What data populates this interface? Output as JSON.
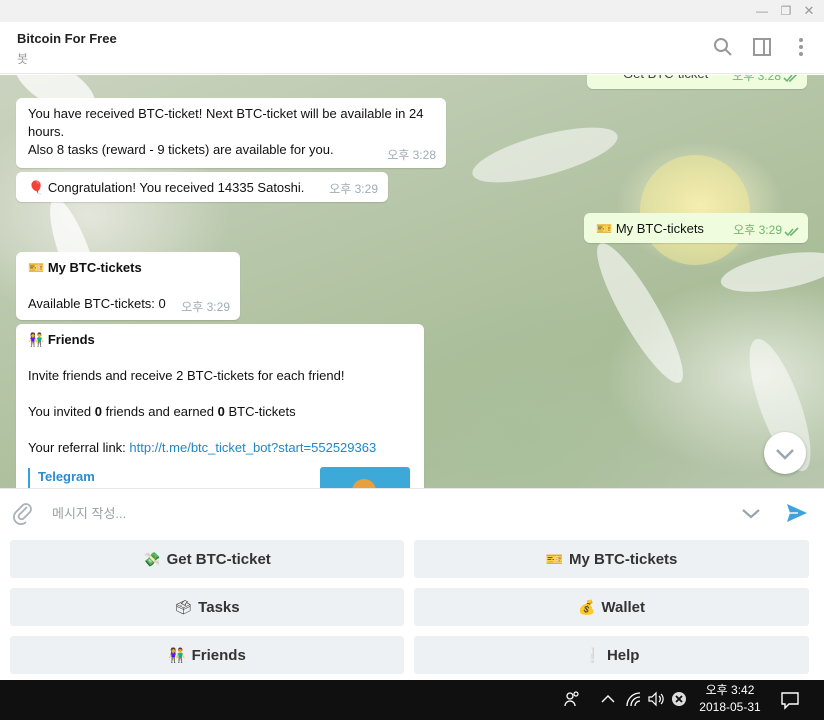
{
  "window": {
    "minimize_icon": "—",
    "maximize_icon": "❐",
    "close_icon": "✕"
  },
  "header": {
    "title": "Bitcoin For Free",
    "subtitle": "봇"
  },
  "messages": {
    "partial_out": {
      "text": "Get BTC-ticket",
      "time": "오후 3:28"
    },
    "received": {
      "line1": "You have received BTC-ticket! Next BTC-ticket will be available in 24",
      "line2": "hours.",
      "line3": "Also 8 tasks (reward - 9 tickets) are available for you.",
      "time": "오후 3:28"
    },
    "congrats": {
      "emoji": "🎈",
      "text": "Congratulation! You received 14335 Satoshi.",
      "time": "오후 3:29"
    },
    "my_tickets_out": {
      "emoji": "🎫",
      "text": "My BTC-tickets",
      "time": "오후 3:29"
    },
    "my_tickets_in": {
      "emoji": "🎫",
      "title": "My BTC-tickets",
      "available_label": "Available BTC-tickets: 0",
      "time": "오후 3:29"
    },
    "friends": {
      "emoji": "👫",
      "title": "Friends",
      "invite": "Invite friends and receive 2 BTC-tickets for each friend!",
      "invited_prefix": "You invited ",
      "invited_count": "0",
      "invited_mid": " friends and earned ",
      "earned_count": "0",
      "invited_suffix": " BTC-tickets",
      "referral_label": "Your referral link: ",
      "referral_link": "http://t.me/btc_ticket_bot?start=552529363",
      "preview_title": "Telegram"
    }
  },
  "compose": {
    "placeholder": "메시지 작성..."
  },
  "keyboard": [
    {
      "emoji": "💸",
      "label": "Get BTC-ticket"
    },
    {
      "emoji": "🎫",
      "label": "My BTC-tickets"
    },
    {
      "emoji": "🗳",
      "label": "Tasks"
    },
    {
      "emoji": "💰",
      "label": "Wallet"
    },
    {
      "emoji": "👫",
      "label": "Friends"
    },
    {
      "emoji": "❕",
      "label": "Help"
    }
  ],
  "taskbar": {
    "time": "오후 3:42",
    "date": "2018-05-31"
  },
  "colors": {
    "accent": "#37a1de",
    "outgoing_bubble": "#effdde",
    "read_check": "#6cb770",
    "link": "#168acd"
  }
}
